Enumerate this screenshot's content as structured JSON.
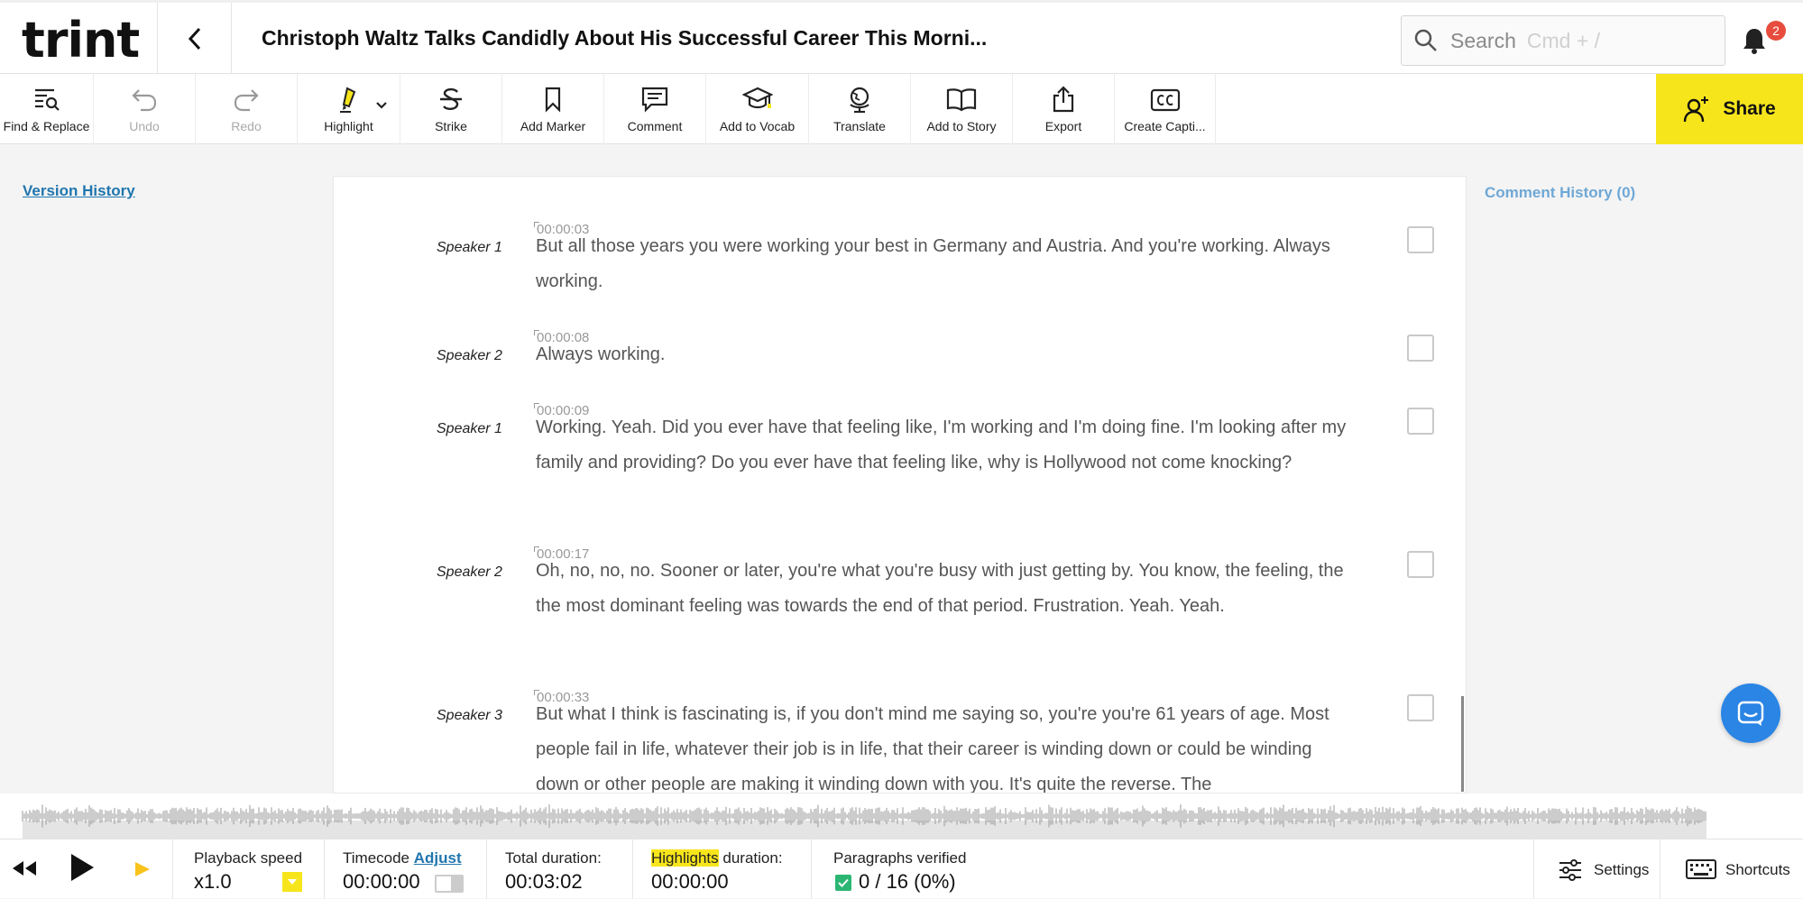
{
  "header": {
    "logo": "trint",
    "title": "Christoph Waltz Talks Candidly About His Successful Career This Morni...",
    "search_placeholder": "Search",
    "search_shortcut": "Cmd + /",
    "notification_count": "2"
  },
  "toolbar": {
    "items": [
      {
        "label": "Find & Replace",
        "icon": "find-replace-icon",
        "enabled": true
      },
      {
        "label": "Undo",
        "icon": "undo-icon",
        "enabled": false
      },
      {
        "label": "Redo",
        "icon": "redo-icon",
        "enabled": false
      },
      {
        "label": "Highlight",
        "icon": "highlighter-icon",
        "enabled": true
      },
      {
        "label": "Strike",
        "icon": "strikethrough-icon",
        "enabled": true
      },
      {
        "label": "Add Marker",
        "icon": "bookmark-icon",
        "enabled": true
      },
      {
        "label": "Comment",
        "icon": "comment-icon",
        "enabled": true
      },
      {
        "label": "Add to Vocab",
        "icon": "graduation-cap-icon",
        "enabled": true
      },
      {
        "label": "Translate",
        "icon": "globe-icon",
        "enabled": true
      },
      {
        "label": "Add to Story",
        "icon": "open-book-icon",
        "enabled": true
      },
      {
        "label": "Export",
        "icon": "export-icon",
        "enabled": true
      },
      {
        "label": "Create Capti...",
        "icon": "closed-caption-icon",
        "enabled": true
      }
    ],
    "share_label": "Share"
  },
  "sidebar": {
    "version_history": "Version History",
    "comment_history": "Comment History (0)"
  },
  "transcript": [
    {
      "speaker": "Speaker 1",
      "timestamp": "00:00:03",
      "text": "But all those years you were working your best in Germany and Austria. And you're working. Always working.",
      "verified": false
    },
    {
      "speaker": "Speaker 2",
      "timestamp": "00:00:08",
      "text": "Always working.",
      "verified": false
    },
    {
      "speaker": "Speaker 1",
      "timestamp": "00:00:09",
      "text": "Working. Yeah. Did you ever have that feeling like, I'm working and I'm doing fine. I'm looking after my family and providing? Do you ever have that feeling like, why is Hollywood not come knocking?",
      "verified": false
    },
    {
      "speaker": "Speaker 2",
      "timestamp": "00:00:17",
      "text": "Oh, no, no, no. Sooner or later, you're what you're busy with just getting by. You know, the feeling, the the most dominant feeling was towards the end of that period. Frustration. Yeah. Yeah.",
      "verified": false
    },
    {
      "speaker": "Speaker 3",
      "timestamp": "00:00:33",
      "text": "But what I think is fascinating is, if you don't mind me saying so, you're you're 61 years of age. Most people fail in life, whatever their job is in life, that their career is winding down or could be winding down or other people are making it winding down with you. It's quite the reverse. The",
      "verified": false
    }
  ],
  "player": {
    "playback_speed_label": "Playback speed",
    "playback_speed_value": "x1.0",
    "timecode_label": "Timecode",
    "adjust_label": "Adjust",
    "timecode_value": "00:00:00",
    "total_duration_label": "Total duration:",
    "total_duration_value": "00:03:02",
    "highlights_word": "Highlights",
    "highlights_suffix": " duration:",
    "highlights_value": "00:00:00",
    "paragraphs_verified_label": "Paragraphs verified",
    "paragraphs_verified_value": "0 / 16 (0%)",
    "settings_label": "Settings",
    "shortcuts_label": "Shortcuts"
  },
  "colors": {
    "accent_yellow": "#f7e51c",
    "link_blue": "#2176ae",
    "intercom_blue": "#2a85e4",
    "badge_red": "#e74c3c"
  }
}
